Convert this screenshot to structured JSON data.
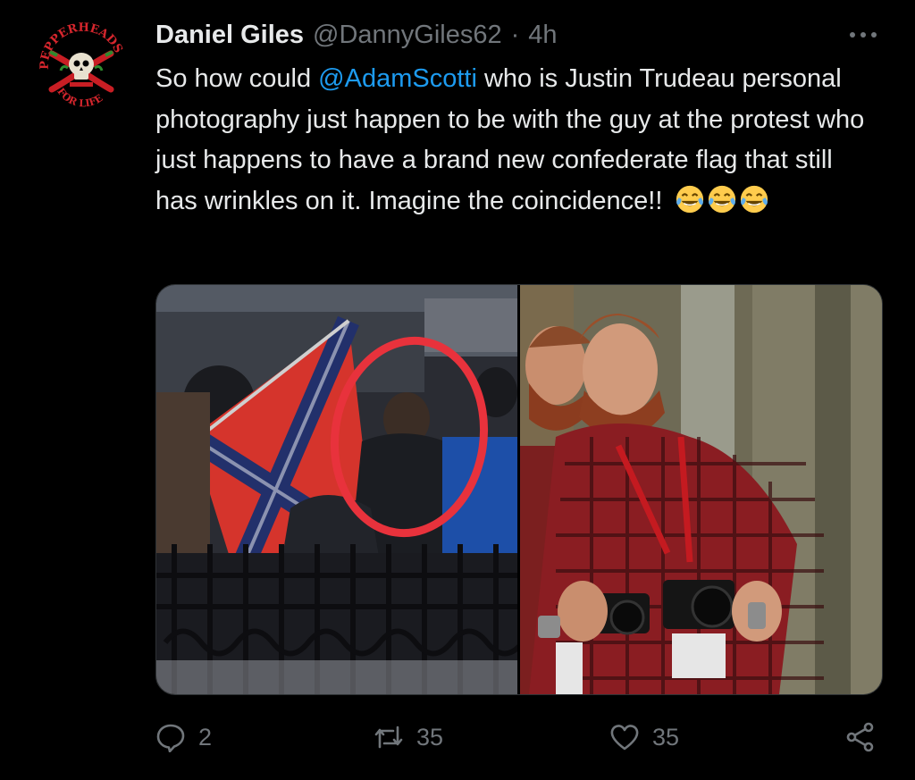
{
  "tweet": {
    "author_name": "Daniel Giles",
    "author_handle": "@DannyGiles62",
    "separator": "·",
    "time_ago": "4h",
    "avatar_text_top": "PEPPERHEADS",
    "avatar_text_bottom": "FOR LIFE",
    "text_before_mention": "So how could ",
    "mention": "@AdamScotti",
    "text_after_mention": " who is Justin Trudeau personal photography just happen to be with the guy at the protest who just happens to have a brand new confederate flag that still has wrinkles on it. Imagine the coincidence!!",
    "emojis": [
      "face-with-tears-of-joy",
      "face-with-tears-of-joy",
      "face-with-tears-of-joy"
    ]
  },
  "media": {
    "left_photo": "protest-crowd-with-confederate-flag-circled",
    "right_photo": "bearded-photographer-in-red-plaid-shirt"
  },
  "actions": {
    "reply_count": "2",
    "retweet_count": "35",
    "like_count": "35"
  },
  "colors": {
    "background": "#000000",
    "text": "#e7e9ea",
    "secondary_text": "#71767b",
    "mention": "#1d9bf0",
    "circle_annotation": "#e8323c"
  }
}
